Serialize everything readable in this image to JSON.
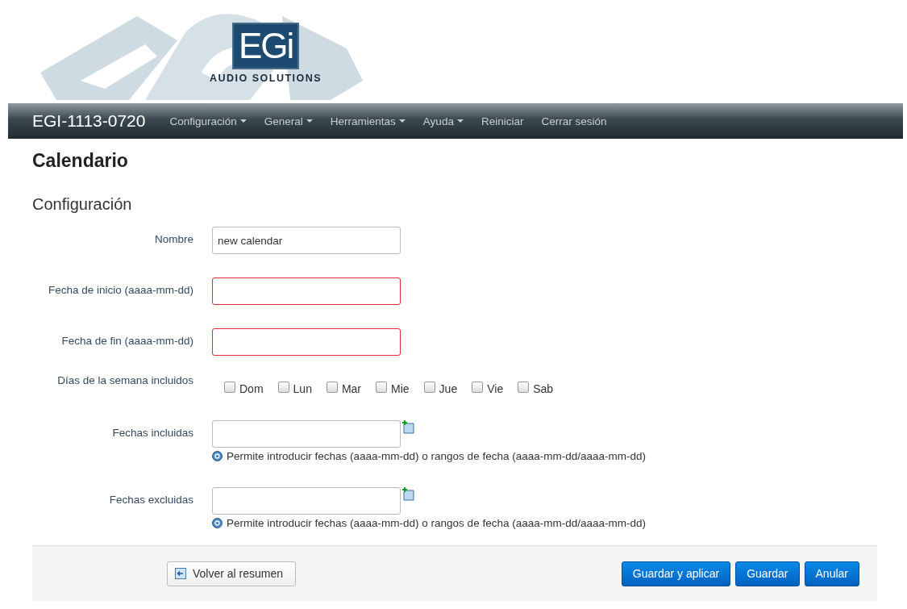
{
  "header": {
    "logo_mark": "EGi",
    "logo_tagline": "AUDIO SOLUTIONS"
  },
  "navbar": {
    "brand": "EGI-1113-0720",
    "items": [
      {
        "label": "Configuración",
        "dropdown": true
      },
      {
        "label": "General",
        "dropdown": true
      },
      {
        "label": "Herramientas",
        "dropdown": true
      },
      {
        "label": "Ayuda",
        "dropdown": true
      },
      {
        "label": "Reiniciar",
        "dropdown": false
      },
      {
        "label": "Cerrar sesión",
        "dropdown": false
      }
    ]
  },
  "page_title": "Calendario",
  "section_title": "Configuración",
  "fields": [
    {
      "kind": "text",
      "label": "Nombre",
      "value": "new calendar",
      "invalid": false
    },
    {
      "kind": "text",
      "label": "Fecha de inicio (aaaa-mm-dd)",
      "invalid": true
    },
    {
      "kind": "text",
      "label": "Fecha de fin (aaaa-mm-dd)",
      "invalid": true
    },
    {
      "kind": "days",
      "label": "Días de la semana incluidos",
      "days": [
        {
          "label": "Dom",
          "checked": false
        },
        {
          "label": "Lun",
          "checked": false
        },
        {
          "label": "Mar",
          "checked": false
        },
        {
          "label": "Mie",
          "checked": false
        },
        {
          "label": "Jue",
          "checked": false
        },
        {
          "label": "Vie",
          "checked": false
        },
        {
          "label": "Sab",
          "checked": false
        }
      ]
    },
    {
      "kind": "dates",
      "label": "Fechas incluidas",
      "hint": "Permite introducir fechas (aaaa-mm-dd) o rangos de fecha (aaaa-mm-dd/aaaa-mm-dd)"
    },
    {
      "kind": "dates",
      "label": "Fechas excluidas",
      "hint": "Permite introducir fechas (aaaa-mm-dd) o rangos de fecha (aaaa-mm-dd/aaaa-mm-dd)"
    }
  ],
  "footer": {
    "back": "Volver al resumen",
    "buttons": [
      "Guardar y aplicar",
      "Guardar",
      "Anular"
    ]
  }
}
